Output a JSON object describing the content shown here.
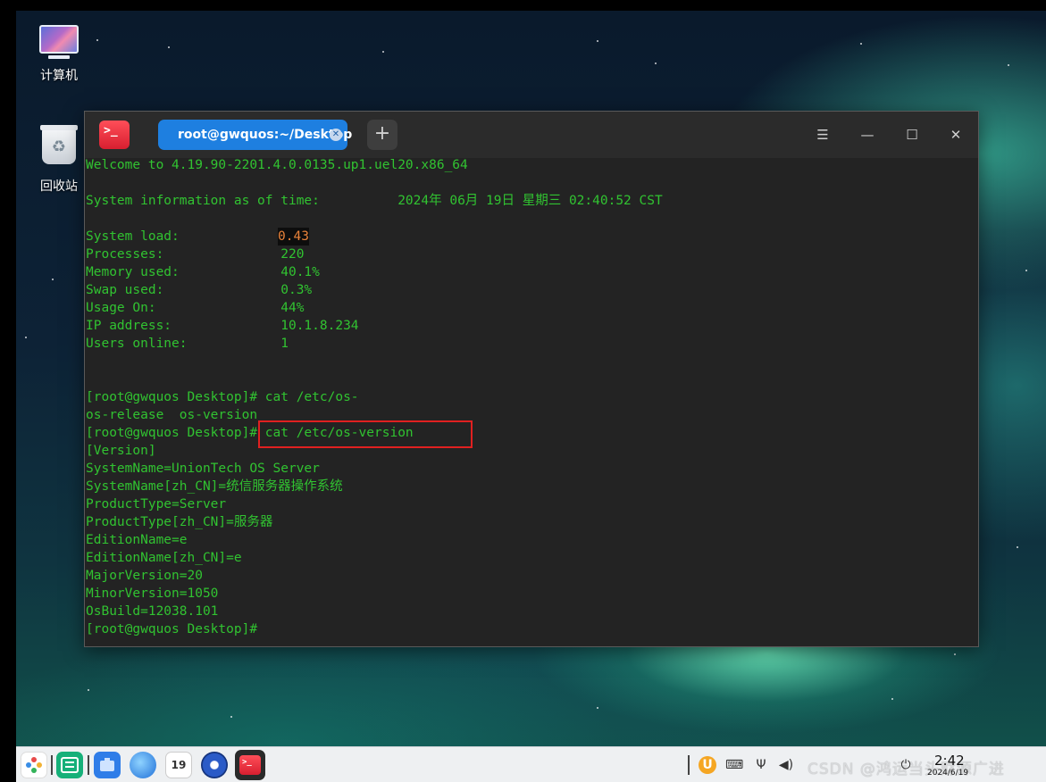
{
  "desktop": {
    "icons": [
      {
        "label": "计算机"
      },
      {
        "label": "回收站"
      }
    ]
  },
  "terminal": {
    "tab_title": "root@gwquos:~/Desktop",
    "lines": [
      "Welcome to 4.19.90-2201.4.0.0135.up1.uel20.x86_64",
      "",
      "System information as of time:          2024年 06月 19日 星期三 02:40:52 CST",
      "",
      "System load:",
      "Processes:               220",
      "Memory used:             40.1%",
      "Swap used:               0.3%",
      "Usage On:                44%",
      "IP address:              10.1.8.234",
      "Users online:            1",
      "",
      "",
      "[root@gwquos Desktop]# cat /etc/os-",
      "os-release  os-version",
      "[root@gwquos Desktop]# cat /etc/os-version",
      "[Version]",
      "SystemName=UnionTech OS Server",
      "SystemName[zh_CN]=统信服务器操作系统",
      "ProductType=Server",
      "ProductType[zh_CN]=服务器",
      "EditionName=e",
      "EditionName[zh_CN]=e",
      "MajorVersion=20",
      "MinorVersion=1050",
      "OsBuild=12038.101",
      "[root@gwquos Desktop]#"
    ],
    "system_load_value": "0.43",
    "colors": {
      "text": "#31c331",
      "highlight_box": "#e02020",
      "tab": "#1e7fe0"
    }
  },
  "taskbar": {
    "calendar_day": "19",
    "watermark": "CSDN @鸿运当头财源广进",
    "clock_time": "2:42",
    "clock_date": "2024/6/19",
    "icons": [
      "launcher-icon",
      "multitask-view-icon",
      "file-manager-icon",
      "browser-icon",
      "calendar-icon",
      "settings-icon",
      "terminal-icon"
    ],
    "tray": [
      "update-icon",
      "keyboard-icon",
      "usb-icon",
      "volume-icon",
      "power-icon"
    ]
  }
}
